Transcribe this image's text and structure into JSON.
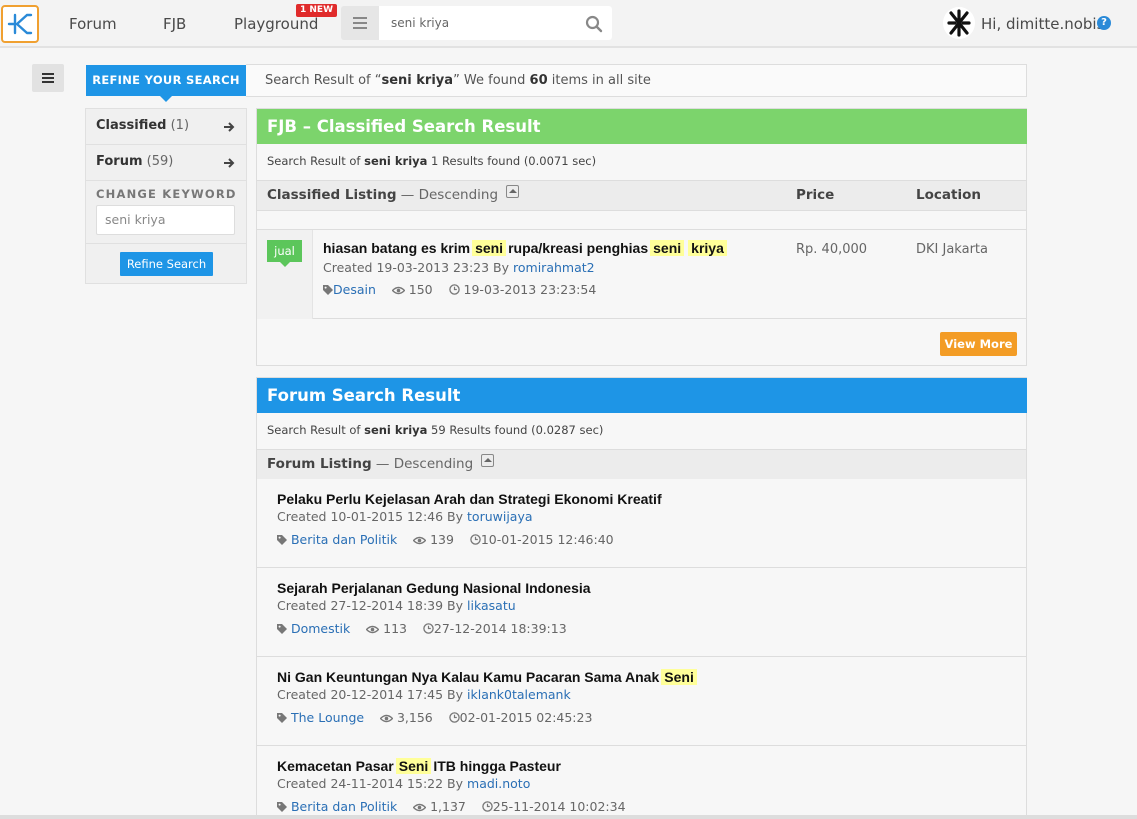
{
  "header": {
    "nav": [
      "Forum",
      "FJB",
      "Playground"
    ],
    "new_badge": "1 NEW",
    "search_value": "seni kriya",
    "greeting": "Hi, dimitte.nobis",
    "help": "?"
  },
  "refine": {
    "tab_label": "REFINE YOUR SEARCH",
    "summary_prefix": "Search Result of “",
    "keyword": "seni kriya",
    "summary_mid": "” We found ",
    "total": "60",
    "summary_suffix": " items in all site"
  },
  "sidebar": {
    "items": [
      {
        "label": "Classified",
        "count": "(1)"
      },
      {
        "label": "Forum",
        "count": "(59)"
      }
    ],
    "change_keyword_label": "CHANGE KEYWORD",
    "keyword_value": "seni kriya",
    "refine_button": "Refine Search"
  },
  "classified": {
    "heading": "FJB – Classified Search Result",
    "sub_prefix": "Search Result of ",
    "sub_keyword": "seni kriya",
    "sub_suffix": " 1 Results found (0.0071 sec)",
    "list_title": "Classified Listing",
    "list_order": " — Descending",
    "col_price": "Price",
    "col_location": "Location",
    "item": {
      "badge": "jual",
      "title_a": "hiasan batang es krim",
      "title_hl1": "seni",
      "title_b": "rupa/kreasi penghias",
      "title_hl2": "seni",
      "title_hl3": "kriya",
      "created": "Created 19-03-2013 23:23 By ",
      "user": "romirahmat2",
      "category": "Desain",
      "views": "150",
      "time": "19-03-2013 23:23:54",
      "price": "Rp. 40,000",
      "location": "DKI Jakarta"
    },
    "view_more": "View More",
    "colors": {
      "heading_bg": "#7cd46c",
      "badge": "#5cc65b",
      "button": "#f39c25"
    }
  },
  "forum": {
    "heading": "Forum Search Result",
    "sub_prefix": "Search Result of ",
    "sub_keyword": "seni kriya",
    "sub_suffix": " 59 Results found (0.0287 sec)",
    "list_title": "Forum Listing",
    "list_order": " — Descending",
    "items": [
      {
        "title": "Pelaku Perlu Kejelasan Arah dan Strategi Ekonomi Kreatif",
        "created": "Created 10-01-2015 12:46 By ",
        "user": "toruwijaya",
        "category": "Berita dan Politik",
        "views": "139",
        "time": "10-01-2015 12:46:40"
      },
      {
        "title": "Sejarah Perjalanan Gedung Nasional Indonesia",
        "created": "Created 27-12-2014 18:39 By ",
        "user": "likasatu",
        "category": "Domestik",
        "views": "113",
        "time": "27-12-2014 18:39:13"
      },
      {
        "title": "Ni Gan Keuntungan Nya Kalau Kamu Pacaran Sama Anak",
        "title_hl": "Seni",
        "created": "Created 20-12-2014 17:45 By ",
        "user": "iklank0talemank",
        "category": "The Lounge",
        "views": "3,156",
        "time": "02-01-2015 02:45:23"
      },
      {
        "title": "Kemacetan Pasar",
        "title_hl": "Seni",
        "title_after": "ITB hingga Pasteur",
        "created": "Created 24-11-2014 15:22 By ",
        "user": "madi.noto",
        "category": "Berita dan Politik",
        "views": "1,137",
        "time": "25-11-2014 10:02:34"
      }
    ],
    "colors": {
      "heading_bg": "#1e95e6"
    }
  }
}
